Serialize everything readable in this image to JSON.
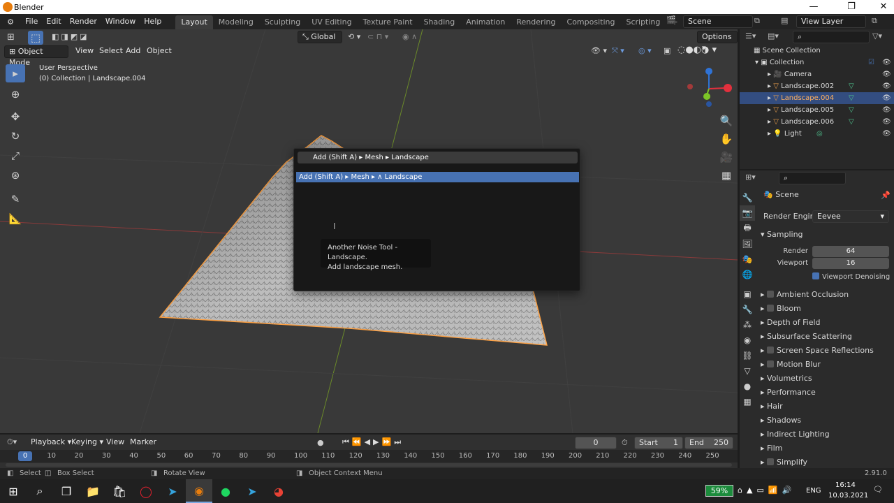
{
  "window": {
    "title": "Blender"
  },
  "menu": [
    "File",
    "Edit",
    "Render",
    "Window",
    "Help"
  ],
  "workspaces": [
    "Layout",
    "Modeling",
    "Sculpting",
    "UV Editing",
    "Texture Paint",
    "Shading",
    "Animation",
    "Rendering",
    "Compositing",
    "Scripting"
  ],
  "scene_name": "Scene",
  "view_layer": "View Layer",
  "viewport": {
    "mode": "Object Mode",
    "header_menus": [
      "View",
      "Select",
      "Add",
      "Object"
    ],
    "transform": "Global",
    "options": "Options",
    "perspective": "User Perspective",
    "collection_info": "(0) Collection | Landscape.004"
  },
  "search": {
    "query": "Add (Shift A) ▸ Mesh ▸ Landscape",
    "result_prefix": "Add (Shift A) ▸ Mesh ▸",
    "result_name": "Landscape",
    "tooltip_line1": "Another Noise Tool - Landscape.",
    "tooltip_line2": "Add landscape mesh."
  },
  "outliner": {
    "root": "Scene Collection",
    "collection": "Collection",
    "items": [
      "Camera",
      "Landscape.002",
      "Landscape.004",
      "Landscape.005",
      "Landscape.006",
      "Light"
    ],
    "selected": "Landscape.004"
  },
  "properties": {
    "context": "Scene",
    "render_engine_label": "Render Engine",
    "render_engine": "Eevee",
    "sampling": "Sampling",
    "render_label": "Render",
    "render_value": "64",
    "viewport_label": "Viewport",
    "viewport_value": "16",
    "denoise": "Viewport Denoising",
    "panels": [
      "Ambient Occlusion",
      "Bloom",
      "Depth of Field",
      "Subsurface Scattering",
      "Screen Space Reflections",
      "Motion Blur",
      "Volumetrics",
      "Performance",
      "Hair",
      "Shadows",
      "Indirect Lighting",
      "Film",
      "Simplify"
    ]
  },
  "timeline": {
    "menus": [
      "Playback",
      "Keying",
      "View",
      "Marker"
    ],
    "frame": "0",
    "start_label": "Start",
    "start": "1",
    "end_label": "End",
    "end": "250",
    "current": "0",
    "ticks": [
      "10",
      "20",
      "30",
      "40",
      "50",
      "60",
      "70",
      "80",
      "90",
      "100",
      "110",
      "120",
      "130",
      "140",
      "150",
      "160",
      "170",
      "180",
      "190",
      "200",
      "210",
      "220",
      "230",
      "240",
      "250"
    ]
  },
  "status": {
    "select": "Select",
    "box_select": "Box Select",
    "rotate": "Rotate View",
    "context_menu": "Object Context Menu",
    "version": "2.91.0"
  },
  "taskbar": {
    "battery": "59%",
    "lang": "ENG",
    "time": "16:14",
    "date": "10.03.2021"
  },
  "colors": {
    "accent": "#4772b3",
    "orange": "#e87d0d",
    "selection": "#ffa040"
  }
}
